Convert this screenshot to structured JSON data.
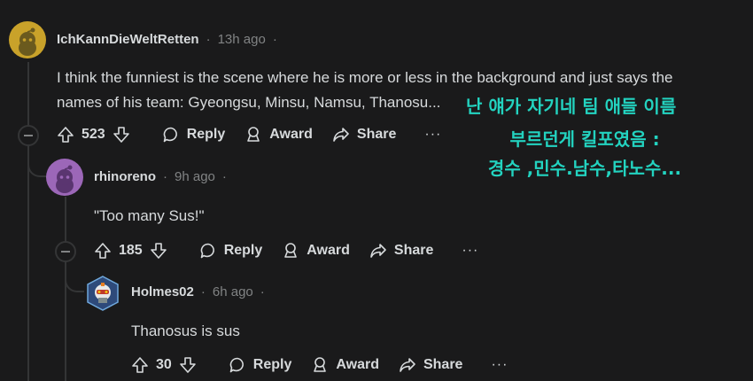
{
  "comments": [
    {
      "username": "IchKannDieWeltRetten",
      "time": "13h ago",
      "body_line1": "I think the funniest is the scene where he is more or less in the background and just says the",
      "body_line2": "names of his team: Gyeongsu, Minsu, Namsu, Thanosu...",
      "votes": "523",
      "reply": "Reply",
      "award": "Award",
      "share": "Share",
      "more": "···"
    },
    {
      "username": "rhinoreno",
      "time": "9h ago",
      "body": "\"Too many Sus!\"",
      "votes": "185",
      "reply": "Reply",
      "award": "Award",
      "share": "Share",
      "more": "···"
    },
    {
      "username": "Holmes02",
      "time": "6h ago",
      "body": "Thanosus is sus",
      "votes": "30",
      "reply": "Reply",
      "award": "Award",
      "share": "Share",
      "more": "···"
    }
  ],
  "overlay": {
    "line1": "난 얘가 자기네 팀 애들 이름",
    "line2": "부르던게 킬포였음 :",
    "line3": "경수 ,민수.남수,타노수..."
  },
  "colors": {
    "background": "#1a1a1b",
    "text": "#d7dadc",
    "meta": "#818384",
    "overlay": "#23d3c0"
  }
}
